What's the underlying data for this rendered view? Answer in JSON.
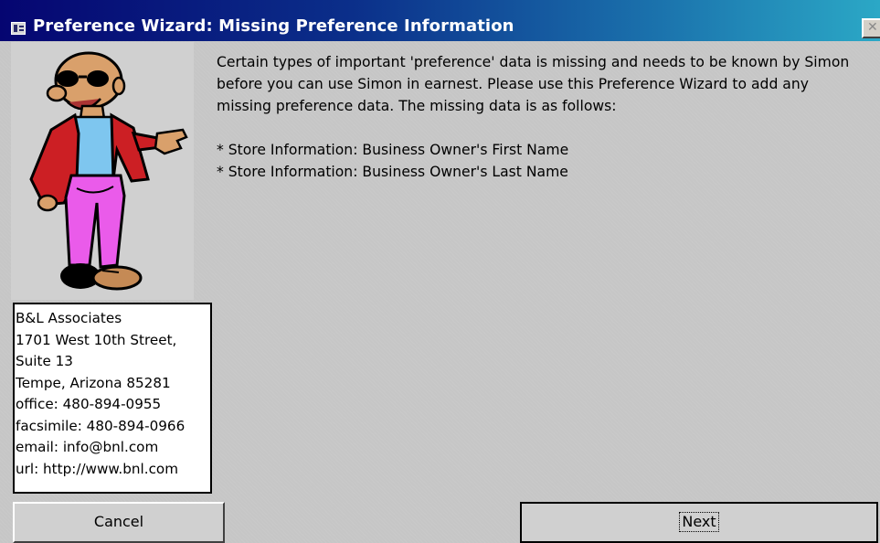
{
  "window": {
    "title": "Preference Wizard: Missing Preference Information",
    "close_glyph": "✕"
  },
  "icons": {
    "title_icon": "form-icon",
    "close_icon": "close-icon"
  },
  "message": {
    "paragraph": "Certain types of important 'preference' data is missing and needs to be known by Simon before you can use Simon in earnest. Please use this Preference Wizard to add any missing preference data. The missing data is as follows:",
    "missing_items": [
      "* Store Information: Business Owner's First Name",
      "* Store Information: Business Owner's Last Name"
    ]
  },
  "address": {
    "lines": [
      "B&L Associates",
      "1701 West 10th Street,",
      "Suite 13",
      "Tempe, Arizona 85281",
      "office: 480-894-0955",
      "facsimile: 480-894-0966",
      "email: info@bnl.com",
      "url: http://www.bnl.com"
    ]
  },
  "buttons": {
    "cancel": "Cancel",
    "next": "Next"
  },
  "colors": {
    "title_gradient_start": "#050571",
    "title_gradient_end": "#2ba8c6",
    "dialog_bg": "#c6c6c6",
    "shirt": "#cc1f24",
    "pants": "#ea5bea",
    "tshirt": "#7ec6ef"
  }
}
